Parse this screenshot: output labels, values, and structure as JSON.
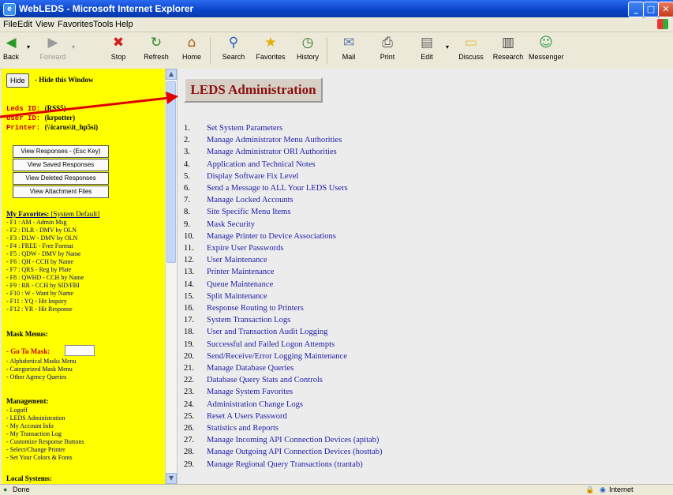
{
  "window": {
    "title": "WebLEDS - Microsoft Internet Explorer"
  },
  "menubar": [
    "File",
    "Edit",
    "View",
    "Favorites",
    "Tools",
    "Help"
  ],
  "toolbar": {
    "back": "Back",
    "forward": "Forward",
    "stop": "Stop",
    "refresh": "Refresh",
    "home": "Home",
    "search": "Search",
    "favorites": "Favorites",
    "history": "History",
    "mail": "Mail",
    "print": "Print",
    "edit": "Edit",
    "discuss": "Discuss",
    "research": "Research",
    "messenger": "Messenger"
  },
  "left": {
    "hide_button": "Hide",
    "hide_label": "- Hide this Window",
    "leds_id_label": "Leds ID:",
    "leds_id_value": "(RSS5)",
    "user_id_label": "User ID:",
    "user_id_value": "(krpotter)",
    "printer_label": "Printer:",
    "printer_value": "(\\\\icarus\\it_hp5si)",
    "buttons": [
      "View Responses - (Esc Key)",
      "View Saved Responses",
      "View Deleted Responses",
      "View Attachment Files"
    ],
    "favorites_title": "My Favorites:",
    "favorites_default": "[System Default]",
    "favorites": [
      "- F1 : AM - Admin Msg",
      "- F2 : DLR - DMV by OLN",
      "- F3 : DLW - DMV by OLN",
      "- F4 : FREE - Free Format",
      "- F5 : QDW - DMV by Name",
      "- F6 : QH - CCH by Name",
      "- F7 : QRS - Reg by Plate",
      "- F8 : QWHD - CCH by Name",
      "- F9 : RR - CCH by SID/FBI",
      "- F10 : W - Want by Name",
      "- F11 : YQ - Hit Inquiry",
      "- F12 : YR - Hit Response"
    ],
    "mask_menus_title": "Mask Menus:",
    "goto_mask": "- Go To Mask:",
    "mask_links": [
      "- Alphabetical Masks Menu",
      "- Categorized Mask Menu",
      "- Other Agency Queries"
    ],
    "management_title": "Management:",
    "management_links": [
      "- Logoff",
      "- LEDS Administration",
      "- My Account Info",
      "- My Transaction Log",
      "- Customize Response Buttons",
      "- Select/Change Printer",
      "- Set Your Colors & Fonts"
    ],
    "local_systems_title": "Local Systems:"
  },
  "main": {
    "title": "LEDS Administration",
    "items": [
      {
        "num": "1.",
        "label": "Set System Parameters"
      },
      {
        "num": "2.",
        "label": "Manage Administrator Menu Authorities"
      },
      {
        "num": "3.",
        "label": "Manage Administrator ORI Authorities"
      },
      {
        "num": "4.",
        "label": "Application and Technical Notes"
      },
      {
        "num": "5.",
        "label": "Display Software Fix Level"
      },
      {
        "num": "6.",
        "label": "Send a Message to ALL Your LEDS Users"
      },
      {
        "num": "7.",
        "label": "Manage Locked Accounts"
      },
      {
        "num": "8.",
        "label": "Site Specific Menu Items"
      },
      {
        "num": "9.",
        "label": "Mask Security"
      },
      {
        "num": "10.",
        "label": "Manage Printer to Device Associations"
      },
      {
        "num": "11.",
        "label": "Expire User Passwords"
      },
      {
        "num": "12.",
        "label": "User Maintenance"
      },
      {
        "num": "13.",
        "label": "Printer Maintenance"
      },
      {
        "num": "14.",
        "label": "Queue Maintenance"
      },
      {
        "num": "15.",
        "label": "Split Maintenance"
      },
      {
        "num": "16.",
        "label": "Response Routing to Printers"
      },
      {
        "num": "17.",
        "label": "System Transaction Logs"
      },
      {
        "num": "18.",
        "label": "User and Transaction Audit Logging"
      },
      {
        "num": "19.",
        "label": "Successful and Failed Logon Attempts"
      },
      {
        "num": "20.",
        "label": "Send/Receive/Error Logging Maintenance"
      },
      {
        "num": "21.",
        "label": "Manage Database Queries"
      },
      {
        "num": "22.",
        "label": "Database Query Stats and Controls"
      },
      {
        "num": "23.",
        "label": "Manage System Favorites"
      },
      {
        "num": "24.",
        "label": "Administration Change Logs"
      },
      {
        "num": "25.",
        "label": "Reset A Users Password"
      },
      {
        "num": "26.",
        "label": "Statistics and Reports"
      },
      {
        "num": "27.",
        "label": "Manage Incoming API Connection Devices (apitab)"
      },
      {
        "num": "28.",
        "label": "Manage Outgoing API Connection Devices (hosttab)"
      },
      {
        "num": "29.",
        "label": "Manage Regional Query Transactions (trantab)"
      }
    ]
  },
  "status": {
    "left": "Done",
    "zone": "Internet"
  },
  "colors": {
    "left_bg": "#ffff00",
    "title_text": "#8b1010",
    "link": "#2020a8",
    "arrow": "#e00000"
  }
}
